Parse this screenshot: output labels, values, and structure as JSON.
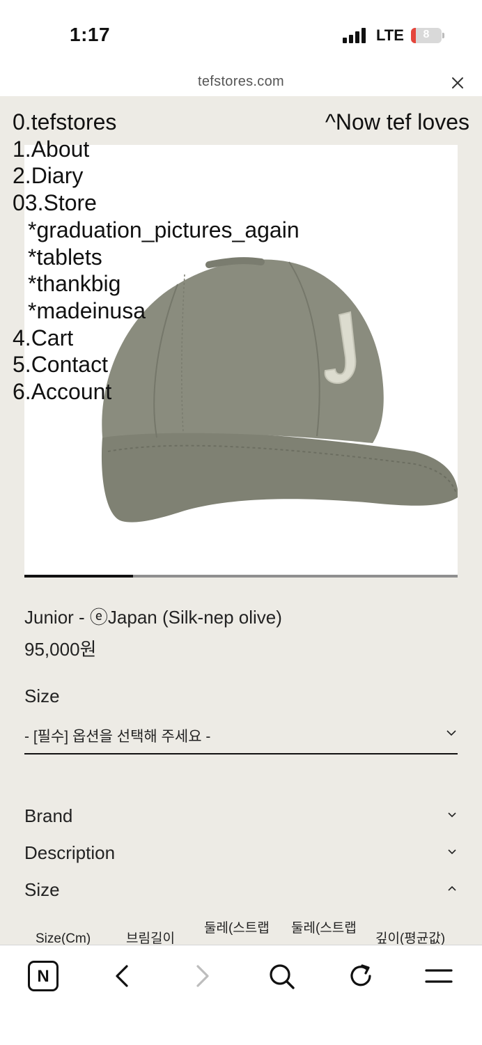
{
  "status": {
    "time": "1:17",
    "network": "LTE",
    "battery": "8"
  },
  "browser": {
    "url": "tefstores.com",
    "close_icon": "close-icon"
  },
  "nav": {
    "items": [
      {
        "label": "0.tefstores"
      },
      {
        "label": "1.About"
      },
      {
        "label": "2.Diary"
      },
      {
        "label": "03.Store"
      },
      {
        "label": "*graduation_pictures_again",
        "sub": true
      },
      {
        "label": "*tablets",
        "sub": true
      },
      {
        "label": "*thankbig",
        "sub": true
      },
      {
        "label": "*madeinusa",
        "sub": true
      },
      {
        "label": "4.Cart"
      },
      {
        "label": "5.Contact"
      },
      {
        "label": "6.Account"
      }
    ],
    "right_link": "^Now tef loves"
  },
  "product": {
    "title": "Junior - ⓔJapan (Silk-nep olive)",
    "price": "95,000원",
    "image_icon": "cap-image",
    "cap_color": "#8a8c7e",
    "carousel_progress": 0.25
  },
  "options": {
    "size_label": "Size",
    "select_placeholder": "- [필수] 옵션을 선택해 주세요 -"
  },
  "accordion": [
    {
      "label": "Brand",
      "state": "collapsed"
    },
    {
      "label": "Description",
      "state": "collapsed"
    },
    {
      "label": "Size",
      "state": "expanded"
    }
  ],
  "size_table": {
    "headers": [
      "Size(Cm)",
      "브림길이",
      "둘레(스트랩",
      "둘레(스트랩",
      "깊이(평균값)"
    ]
  },
  "toolbar": {
    "icons": [
      "naver-home-icon",
      "back-icon",
      "forward-icon",
      "search-icon",
      "reload-icon",
      "menu-icon"
    ],
    "home_letter": "N"
  }
}
